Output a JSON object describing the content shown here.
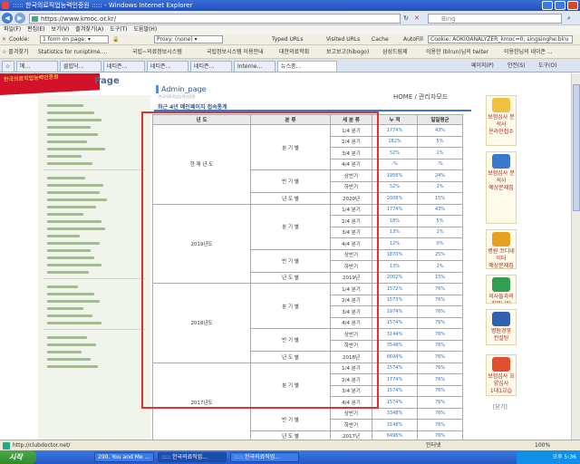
{
  "window": {
    "title": "::::: 한국의료직업능력인증원 ::::: - Windows Internet Explorer"
  },
  "address": {
    "url": "https://www.kmoc.or.kr/",
    "search_placeholder": "Bing"
  },
  "menu": [
    "파일(F)",
    "편집(E)",
    "보기(V)",
    "즐겨찾기(A)",
    "도구(T)",
    "도움말(H)"
  ],
  "toolbar1": {
    "cookie_label": "Cookie:",
    "form_select": "1 form on page:",
    "proxy": "Proxy: (none)",
    "typed_urls": "Typed URLs",
    "visited_urls": "Visited URLs",
    "cache": "Cache",
    "autofill": "AutoFill",
    "cookie_value": "Cookie: AOKIOANALYZER_kmoc=0; singsinghe:blru"
  },
  "toolbar2": {
    "favorites": "즐겨찾기",
    "links": [
      "Statistics for runiptime....",
      "국립~의료정보시스템",
      "국립정보시스템 이용안내",
      "대한의료학회",
      "보고보고(hibogo)",
      "삼성드림제",
      "이용한 (blrun)님의 twiter",
      "이용한님의 네이존 ..."
    ]
  },
  "tabs": [
    "메...",
    "클립닥...",
    "네티즌...",
    "네티즌...",
    "네티즌...",
    "Interne...",
    "뉴스종..."
  ],
  "tab_tools": [
    "페이지(P)",
    "안전(S)",
    "도구(O)"
  ],
  "header": {
    "logo_text": "한국의료직업능력인증원",
    "page_word": "Page"
  },
  "page": {
    "admin_title": "Admin_page",
    "admin_sub": "한국의료직업능력인증원",
    "breadcrumb": "HOME / 관리자모드",
    "subtitle": "최근 4년 메인페이지 접속통계"
  },
  "table": {
    "headers": [
      "년 도",
      "분 류",
      "세 분 류",
      "누 적",
      "일일평균"
    ],
    "quarter_label": "분 기 별",
    "half_label": "반 기 별",
    "annual_label": "년 도 별",
    "quarters": [
      "1/4 분기",
      "2/4 분기",
      "3/4 분기",
      "4/4 분기"
    ],
    "halves": [
      "상반기",
      "하반기"
    ],
    "years": [
      {
        "label": "현 재 년 도",
        "annual": "2020년",
        "values": [
          [
            "1774%",
            "43%"
          ],
          [
            "182%",
            "5%"
          ],
          [
            "52%",
            "1%"
          ],
          [
            "-%",
            "-%"
          ],
          [
            "1956%",
            "24%"
          ],
          [
            "52%",
            "1%"
          ],
          [
            "2008%",
            "15%"
          ]
        ]
      },
      {
        "label": "2019년도",
        "annual": "2019년",
        "values": [
          [
            "1774%",
            "43%"
          ],
          [
            "18%",
            "5%"
          ],
          [
            "13%",
            "1%"
          ],
          [
            "12%",
            "0%"
          ],
          [
            "1870%",
            "25%"
          ],
          [
            "13%",
            "1%"
          ],
          [
            "2002%",
            "15%"
          ]
        ]
      },
      {
        "label": "2018년도",
        "annual": "2018년",
        "values": [
          [
            "1572%",
            "76%"
          ],
          [
            "1573%",
            "76%"
          ],
          [
            "1974%",
            "76%"
          ],
          [
            "1574%",
            "76%"
          ],
          [
            "3144%",
            "76%"
          ],
          [
            "3548%",
            "76%"
          ],
          [
            "6694%",
            "76%"
          ]
        ]
      },
      {
        "label": "2017년도",
        "annual": "2017년",
        "values": [
          [
            "1574%",
            "76%"
          ],
          [
            "1774%",
            "76%"
          ],
          [
            "1574%",
            "76%"
          ],
          [
            "1574%",
            "76%"
          ],
          [
            "3348%",
            "76%"
          ],
          [
            "3148%",
            "76%"
          ],
          [
            "6496%",
            "76%"
          ]
        ]
      }
    ]
  },
  "ads": [
    {
      "label": "보험심사 분석사",
      "sub": "온라인접수",
      "color": "#f0c040"
    },
    {
      "label": "보험심사 분석사",
      "sub": "예상문제집",
      "color": "#3a78d0"
    },
    {
      "label": "병원 코디네이터",
      "sub": "예상문제집",
      "color": "#e8a020"
    },
    {
      "label": "의사들과의",
      "sub": "커뮤니티",
      "color": "#30a050"
    },
    {
      "label": "병원경영",
      "sub": "컨설팅",
      "color": "#3060b0"
    },
    {
      "label": "보험심사 요양심사",
      "sub": "1대1교습",
      "color": "#e05030"
    }
  ],
  "ads_close": "[닫기]",
  "status": {
    "text": "http://clubdoctor.net/",
    "zone": "인터넷",
    "zoom": "100%"
  },
  "taskbar": {
    "start": "시작",
    "tasks": [
      "290. You and Me ...",
      "::::: 한국의료직업...",
      "::::: 한국의료직업..."
    ],
    "clock": "오후 5:36"
  }
}
